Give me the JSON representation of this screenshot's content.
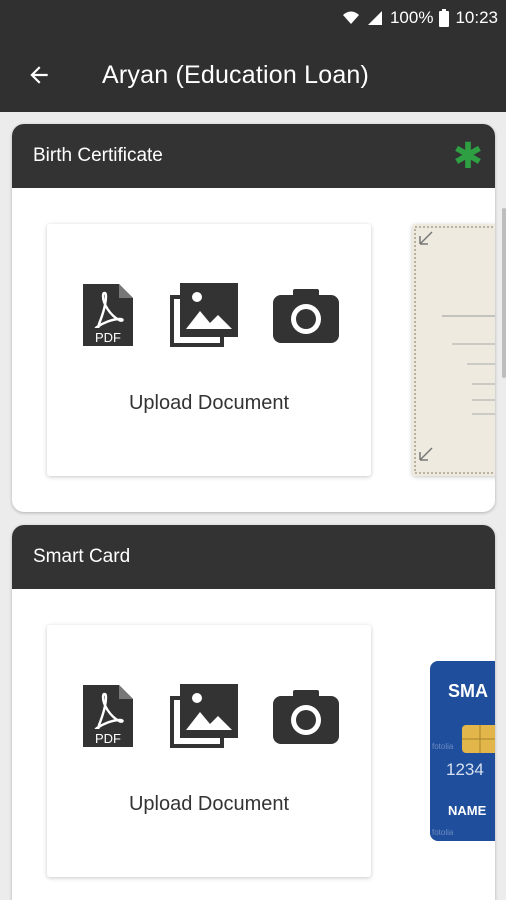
{
  "status_bar": {
    "battery": "100%",
    "time": "10:23"
  },
  "toolbar": {
    "title": "Aryan (Education Loan)"
  },
  "cards": [
    {
      "title": "Birth Certificate",
      "required_mark": "✱",
      "upload_label": "Upload Document",
      "pdf_label": "PDF"
    },
    {
      "title": "Smart Card",
      "upload_label": "Upload Document",
      "pdf_label": "PDF"
    }
  ],
  "preview_smart_card": {
    "brand": "SMA",
    "number": "1234",
    "name": "NAME",
    "watermark": "fotolia"
  },
  "colors": {
    "appbar": "#303030",
    "header": "#333333",
    "required": "#2ea043",
    "card_blue": "#1f4e9c"
  }
}
